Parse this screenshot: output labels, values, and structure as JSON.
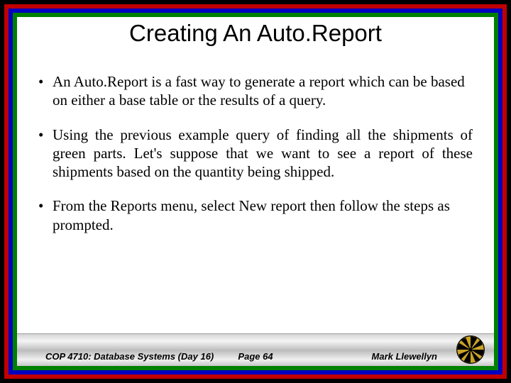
{
  "title": "Creating  An Auto.Report",
  "bullets": [
    {
      "text": "An Auto.Report is a fast way to generate a report which can be based on either a base table or the results of a query.",
      "justify": false
    },
    {
      "text": "Using the previous example query of finding all the shipments of green parts.  Let's suppose that we want to see a report of these shipments based on the quantity being shipped.",
      "justify": true
    },
    {
      "text": "From the Reports menu, select New report then follow the steps as prompted.",
      "justify": false
    }
  ],
  "footer": {
    "left": "COP 4710: Database Systems  (Day 16)",
    "center": "Page 64",
    "right": "Mark Llewellyn"
  }
}
